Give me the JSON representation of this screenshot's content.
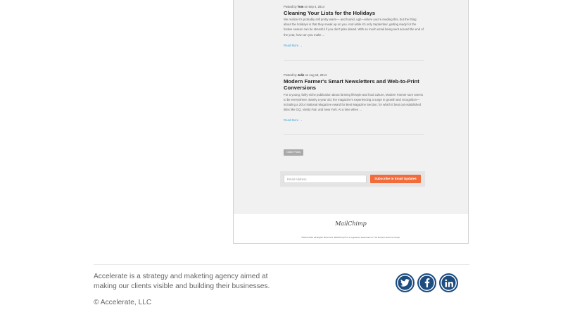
{
  "posts": [
    {
      "meta_prefix": "Posted by",
      "author": "Tom",
      "date_text": "on Sep 4, 2014",
      "title": "Cleaning Your Lists for the Holidays",
      "body": "We realize it's probably still pretty warm— and humid, ugh—where you're reading this, but the thing about the holidays is that they sneak up on you. And while it's only September, getting ready for the festive season can be stressful if you don't plan ahead. With so much email being sent around the end of the year, how can you make ...",
      "read_more": "Read More →"
    },
    {
      "meta_prefix": "Posted by",
      "author": "Julie",
      "date_text": "on Aug 18, 2014",
      "title": "Modern Farmer's Smart Newsletters and Web-to-Print Conversions",
      "body": "For a young, fairly niche publication about farming lifestyle and food culture, Modern Farmer sure seems to be everywhere. Barely a year old, the magazine's experiencing a surge in growth and recognition—including a 2014 National Magazine Award for Best Magazine Section, for which it beat out established titles like GQ, Vanity Fair, and New York. At a time when ...",
      "read_more": "Read More →"
    }
  ],
  "older_posts_label": "Older Posts",
  "subscribe": {
    "email_placeholder": "Email Address",
    "button_label": "Subscribe to Email Updates",
    "button_color": "#f26b3a"
  },
  "frame_footer": {
    "logo_text": "MailChimp",
    "legal": "©2001-2014 All Rights Reserved. MailChimp® is a registered trademark of The Rocket Science Group."
  },
  "site_footer": {
    "tagline": "Accelerate is a strategy and maketing agency aimed at making our clients visible and building their businesses.",
    "copyright": "© Accelerate, LLC"
  },
  "social": [
    {
      "network": "twitter",
      "icon": "twitter-icon"
    },
    {
      "network": "facebook",
      "icon": "facebook-icon"
    },
    {
      "network": "linkedin",
      "icon": "linkedin-icon"
    }
  ],
  "colors": {
    "accent_link": "#3aa4d8",
    "social_blue": "#1d4c80"
  }
}
